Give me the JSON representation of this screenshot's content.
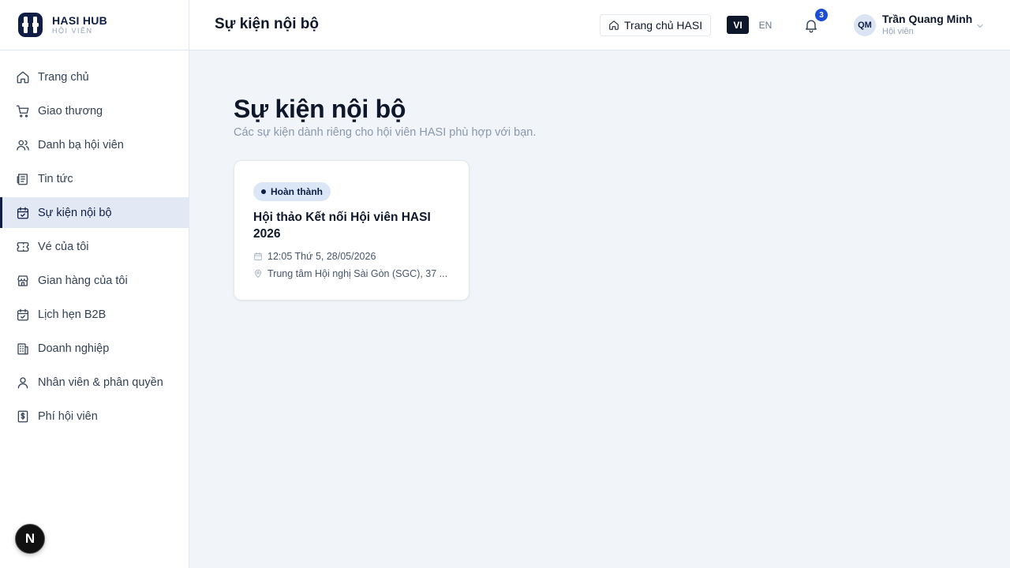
{
  "brand": {
    "name": "HASI HUB",
    "subtitle": "HỘI VIÊN"
  },
  "sidebar": {
    "items": [
      {
        "label": "Trang chủ",
        "icon": "home-icon"
      },
      {
        "label": "Giao thương",
        "icon": "cart-icon"
      },
      {
        "label": "Danh bạ hội viên",
        "icon": "users-icon"
      },
      {
        "label": "Tin tức",
        "icon": "newspaper-icon"
      },
      {
        "label": "Sự kiện nội bộ",
        "icon": "calendar-check-icon",
        "active": true
      },
      {
        "label": "Vé của tôi",
        "icon": "ticket-icon"
      },
      {
        "label": "Gian hàng của tôi",
        "icon": "store-icon"
      },
      {
        "label": "Lịch hẹn B2B",
        "icon": "calendar-check-icon"
      },
      {
        "label": "Doanh nghiệp",
        "icon": "building-icon"
      },
      {
        "label": "Nhân viên & phân quyền",
        "icon": "user-icon"
      },
      {
        "label": "Phí hội viên",
        "icon": "dollar-receipt-icon"
      }
    ]
  },
  "floating_badge": {
    "label": "N"
  },
  "header": {
    "title": "Sự kiện nội bộ",
    "home_button": "Trang chủ HASI",
    "lang_vi": "VI",
    "lang_en": "EN",
    "notification_count": "3",
    "user": {
      "initials": "QM",
      "name": "Trần Quang Minh",
      "role": "Hội viên"
    }
  },
  "main": {
    "heading": "Sự kiện nội bộ",
    "subtitle": "Các sự kiện dành riêng cho hội viên HASI phù hợp với bạn.",
    "events": [
      {
        "status": "Hoàn thành",
        "title": "Hội thảo Kết nối Hội viên HASI 2026",
        "datetime": "12:05 Thứ 5, 28/05/2026",
        "location": "Trung tâm Hội nghị Sài Gòn (SGC), 37 ..."
      }
    ]
  },
  "colors": {
    "primary": "#0f1e45",
    "accent": "#1d4ed8",
    "badge_bg": "#dbe7f7"
  }
}
